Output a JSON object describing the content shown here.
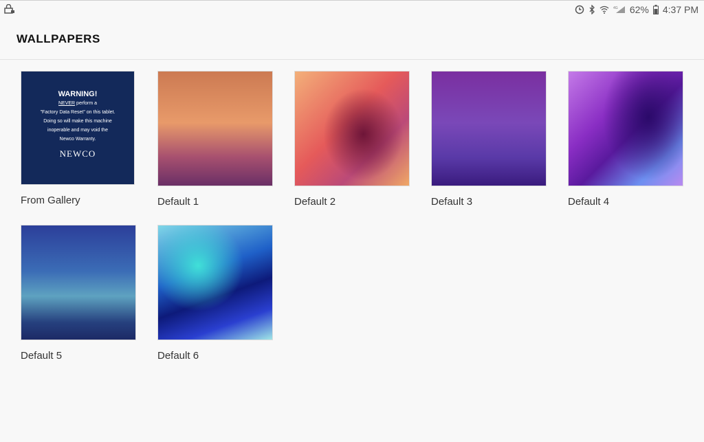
{
  "status_bar": {
    "left_icon": "lock-bag-icon",
    "right_icons": [
      "sync-icon",
      "bluetooth-icon",
      "wifi-icon",
      "lte-signal-icon",
      "battery-icon"
    ],
    "battery_percent": "62%",
    "time": "4:37 PM"
  },
  "header": {
    "title": "WALLPAPERS"
  },
  "gallery_thumb": {
    "warning_title": "WARNING!",
    "never": "NEVER",
    "line1_rest": " perform a",
    "line2": "\"Factory Data Reset\" on this tablet.",
    "line3": "Doing so will make this machine",
    "line4": "inoperable and may void the",
    "line5": "Newco Warranty.",
    "logo": "NEWCO"
  },
  "wallpapers": [
    {
      "label": "From Gallery"
    },
    {
      "label": "Default 1"
    },
    {
      "label": "Default 2"
    },
    {
      "label": "Default 3"
    },
    {
      "label": "Default 4"
    },
    {
      "label": "Default 5"
    },
    {
      "label": "Default 6"
    }
  ],
  "colors": {
    "background": "#f8f8f8",
    "gallery_bg": "#13295a"
  }
}
